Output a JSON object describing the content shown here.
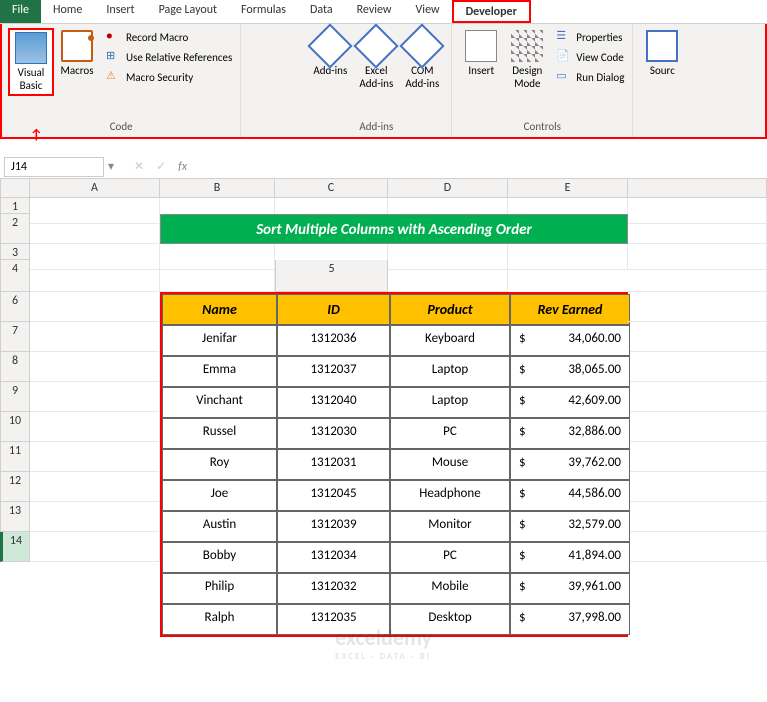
{
  "tabs": {
    "file": "File",
    "home": "Home",
    "insert": "Insert",
    "pagelayout": "Page Layout",
    "formulas": "Formulas",
    "data": "Data",
    "review": "Review",
    "view": "View",
    "developer": "Developer"
  },
  "ribbon": {
    "code": {
      "visual_basic": "Visual Basic",
      "macros": "Macros",
      "record_macro": "Record Macro",
      "use_relative": "Use Relative References",
      "macro_security": "Macro Security",
      "group_label": "Code"
    },
    "addins": {
      "addins": "Add-ins",
      "excel_addins": "Excel Add-ins",
      "com_addins": "COM Add-ins",
      "group_label": "Add-ins"
    },
    "controls": {
      "insert": "Insert",
      "design_mode": "Design Mode",
      "properties": "Properties",
      "view_code": "View Code",
      "run_dialog": "Run Dialog",
      "group_label": "Controls"
    },
    "xml": {
      "source": "Sourc"
    }
  },
  "formula_bar": {
    "name_box": "J14",
    "fx": "fx"
  },
  "columns": [
    "A",
    "B",
    "C",
    "D",
    "E"
  ],
  "sheet": {
    "title": "Sort Multiple Columns with Ascending Order",
    "headers": {
      "name": "Name",
      "id": "ID",
      "product": "Product",
      "rev": "Rev Earned"
    },
    "rows": [
      {
        "name": "Jenifar",
        "id": "1312036",
        "product": "Keyboard",
        "rev": "34,060.00"
      },
      {
        "name": "Emma",
        "id": "1312037",
        "product": "Laptop",
        "rev": "38,065.00"
      },
      {
        "name": "Vinchant",
        "id": "1312040",
        "product": "Laptop",
        "rev": "42,609.00"
      },
      {
        "name": "Russel",
        "id": "1312030",
        "product": "PC",
        "rev": "32,886.00"
      },
      {
        "name": "Roy",
        "id": "1312031",
        "product": "Mouse",
        "rev": "39,762.00"
      },
      {
        "name": "Joe",
        "id": "1312045",
        "product": "Headphone",
        "rev": "44,586.00"
      },
      {
        "name": "Austin",
        "id": "1312039",
        "product": "Monitor",
        "rev": "32,579.00"
      },
      {
        "name": "Bobby",
        "id": "1312034",
        "product": "PC",
        "rev": "41,894.00"
      },
      {
        "name": "Philip",
        "id": "1312032",
        "product": "Mobile",
        "rev": "39,961.00"
      },
      {
        "name": "Ralph",
        "id": "1312035",
        "product": "Desktop",
        "rev": "37,998.00"
      }
    ]
  },
  "watermark": {
    "brand": "exceldemy",
    "tagline": "EXCEL · DATA · BI"
  }
}
